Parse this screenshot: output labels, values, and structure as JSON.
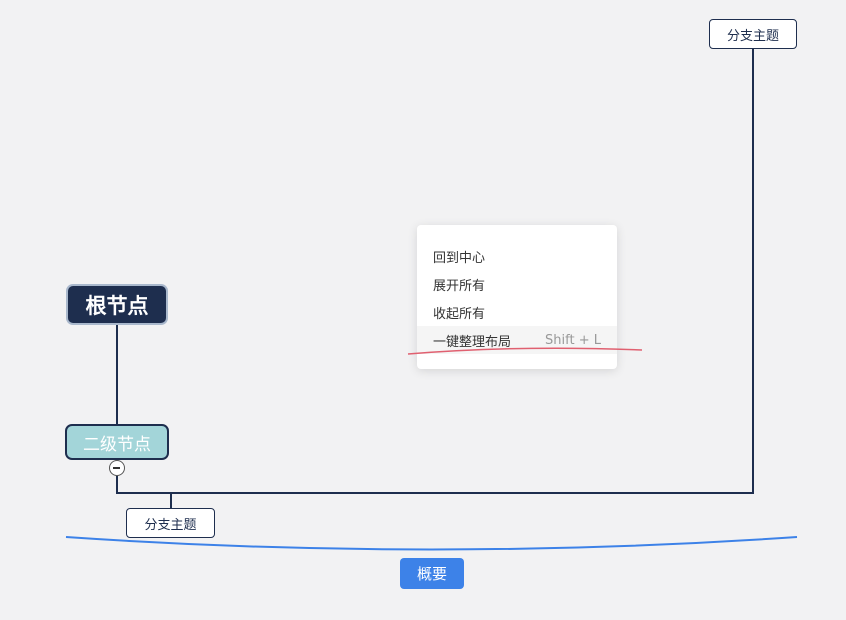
{
  "mindmap": {
    "root": {
      "label": "根节点"
    },
    "level2": {
      "label": "二级节点"
    },
    "branch_top": {
      "label": "分支主题"
    },
    "branch_bottom": {
      "label": "分支主题"
    },
    "summary": {
      "label": "概要"
    }
  },
  "context_menu": {
    "items": [
      {
        "label": "回到中心",
        "shortcut": ""
      },
      {
        "label": "展开所有",
        "shortcut": ""
      },
      {
        "label": "收起所有",
        "shortcut": ""
      },
      {
        "label": "一键整理布局",
        "shortcut": "Shift + L"
      }
    ]
  },
  "colors": {
    "root_fill": "#1e2e4e",
    "level2_fill": "#a3d5d9",
    "line": "#1e2e4e",
    "summary_accent": "#3d82e8",
    "annotation_underline": "#e06070"
  },
  "icons": {
    "collapse_toggle": "minus-circle-icon"
  }
}
